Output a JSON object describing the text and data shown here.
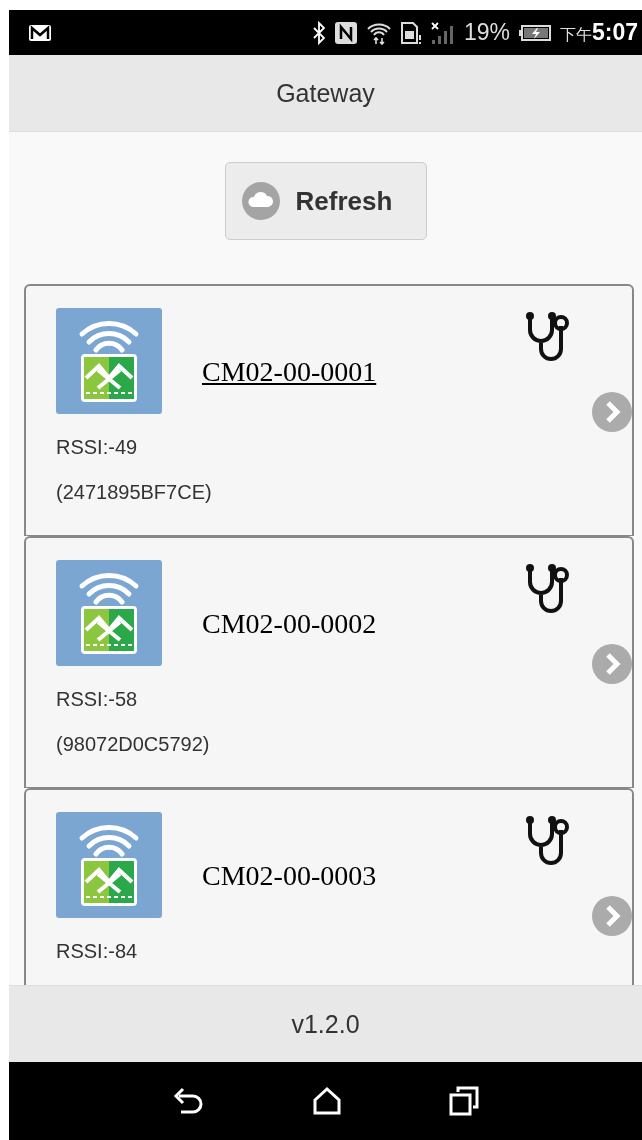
{
  "status_bar": {
    "battery": "19%",
    "time_prefix": "下午",
    "time": "5:07"
  },
  "header": {
    "title": "Gateway"
  },
  "refresh_button": {
    "label": "Refresh"
  },
  "gateways": [
    {
      "name": "CM02-00-0001",
      "underlined": true,
      "rssi": "RSSI:-49",
      "address": "(2471895BF7CE)"
    },
    {
      "name": "CM02-00-0002",
      "underlined": false,
      "rssi": "RSSI:-58",
      "address": "(98072D0C5792)"
    },
    {
      "name": "CM02-00-0003",
      "underlined": false,
      "rssi": "RSSI:-84"
    }
  ],
  "footer": {
    "version": "v1.2.0"
  }
}
